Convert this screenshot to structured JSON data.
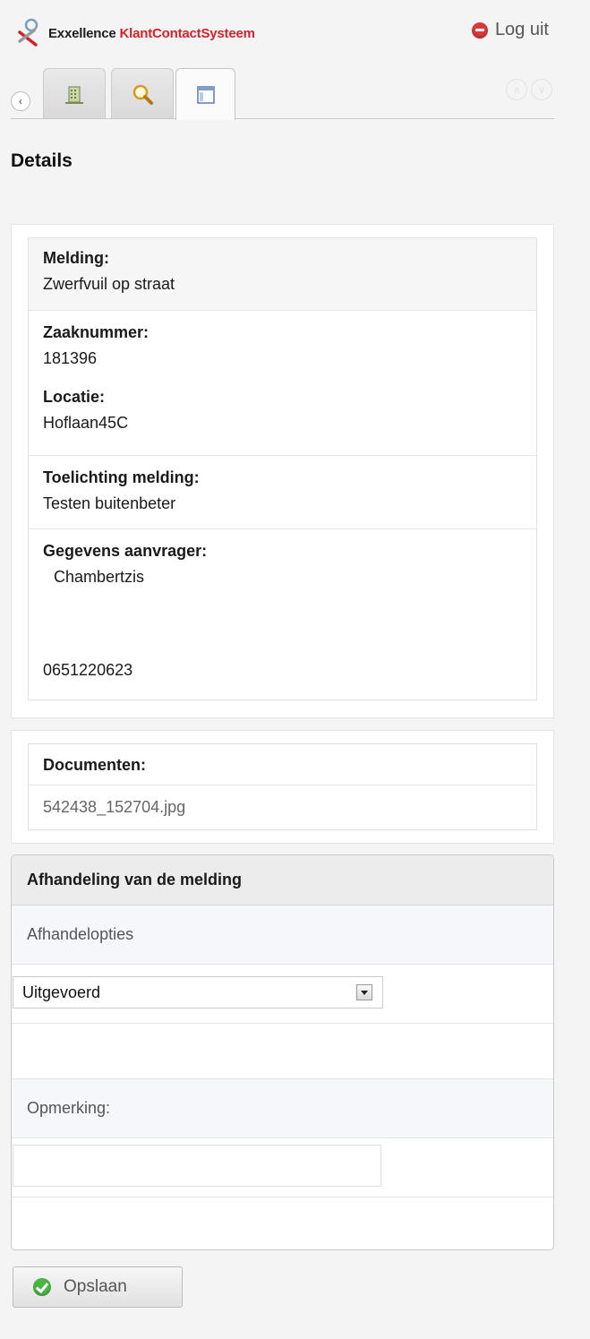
{
  "header": {
    "brand_part1": "Exxellence",
    "brand_part2": "KlantContactSysteem",
    "logout_label": "Log uit",
    "brand_color": "#d3222a"
  },
  "tabs": [
    {
      "icon": "building-icon",
      "active": false
    },
    {
      "icon": "search-icon",
      "active": false
    },
    {
      "icon": "details-window-icon",
      "active": true
    }
  ],
  "page_title": "Details",
  "details": {
    "melding_label": "Melding:",
    "melding_value": "Zwerfvuil op straat",
    "zaaknummer_label": "Zaaknummer:",
    "zaaknummer_value": "181396",
    "locatie_label": "Locatie:",
    "locatie_value": "Hoflaan45C",
    "toelichting_label": "Toelichting melding:",
    "toelichting_value": "Testen buitenbeter",
    "aanvrager_label": "Gegevens aanvrager:",
    "aanvrager_name": "Chambertzis",
    "aanvrager_phone": "0651220623"
  },
  "documents": {
    "label": "Documenten:",
    "files": [
      "542438_152704.jpg"
    ]
  },
  "afhandeling": {
    "title": "Afhandeling van de melding",
    "options_label": "Afhandelopties",
    "selected_option": "Uitgevoerd",
    "remark_label": "Opmerking:",
    "remark_value": ""
  },
  "save_label": "Opslaan"
}
